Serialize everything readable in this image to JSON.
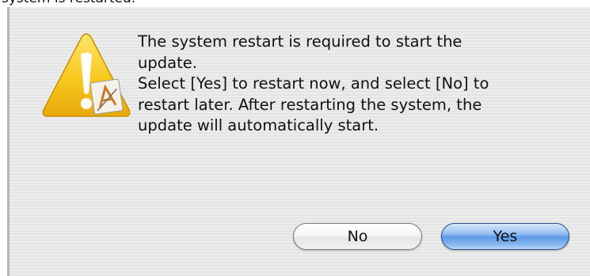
{
  "top_strip_text": "system is restarted.",
  "dialog": {
    "icon": "alert-warning-icon",
    "message_lines": [
      "The system restart is required to start the",
      "update.",
      "Select [Yes] to restart now, and select [No] to",
      "restart later. After restarting the system, the",
      "update will automatically start."
    ],
    "buttons": {
      "no_label": "No",
      "yes_label": "Yes"
    }
  },
  "colors": {
    "warning_yellow": "#f2c418",
    "default_button_blue": "#6aa6ea"
  }
}
